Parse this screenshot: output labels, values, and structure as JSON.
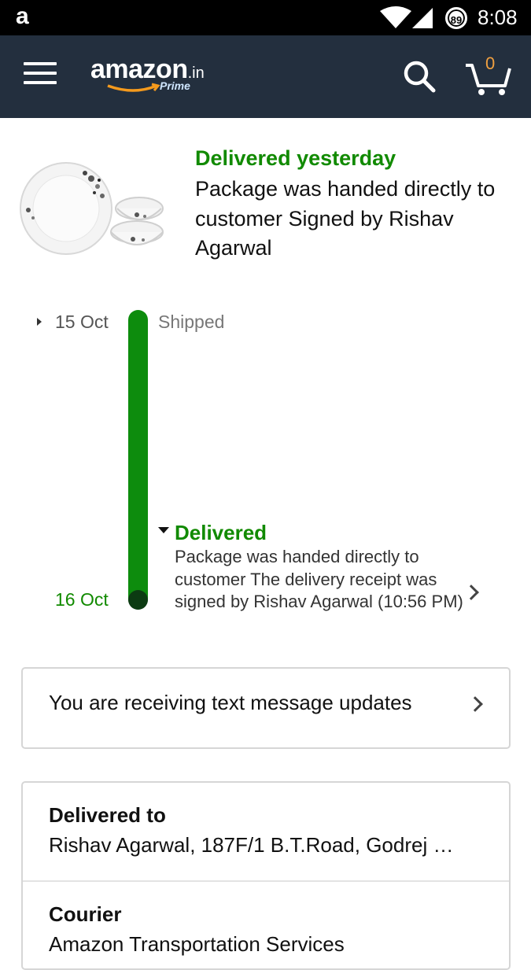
{
  "statusbar": {
    "app_icon": "a",
    "battery": "89",
    "time": "8:08"
  },
  "header": {
    "logo_main": "amazon",
    "logo_tld": ".in",
    "logo_sub": "Prime",
    "cart_count": "0",
    "icons": [
      "menu-icon",
      "search-icon",
      "cart-icon"
    ],
    "brand_color": "#232f3e"
  },
  "summary": {
    "heading": "Delivered yesterday",
    "detail": "Package was handed directly to customer Signed by Rishav Agarwal"
  },
  "timeline": {
    "start_date": "15 Oct",
    "start_label": "Shipped",
    "end_date": "16 Oct",
    "event_title": "Delivered",
    "event_detail": "Package was handed directly to customer The delivery receipt was signed by Rishav Agarwal (10:56 PM)",
    "progress_color": "#0d8c0d",
    "status_color": "#118a00"
  },
  "sms_card": {
    "text": "You are receiving text message updates"
  },
  "info_card": {
    "delivered_to_label": "Delivered to",
    "delivered_to_value": "Rishav Agarwal, 187F/1 B.T.Road, Godrej …",
    "courier_label": "Courier",
    "courier_value": "Amazon Transportation Services"
  }
}
